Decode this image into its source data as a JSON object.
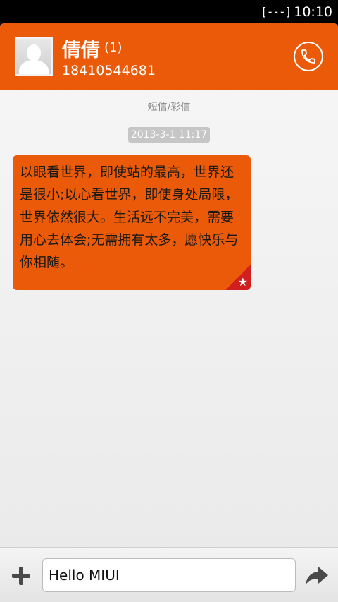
{
  "status_bar": {
    "signal": "[---]",
    "time": "10:10"
  },
  "header": {
    "contact_name": "倩倩",
    "unread_count": "(1)",
    "phone_number": "18410544681"
  },
  "conversation": {
    "type_label": "短信/彩信",
    "timestamp": "2013-3-1 11:17",
    "message": {
      "text": "以眼看世界，即使站的最高，世界还是很小;以心看世界，即使身处局限，世界依然很大。生活远不完美，需要用心去体会;无需拥有太多，愿快乐与你相随。",
      "badge": "★"
    }
  },
  "composer": {
    "input_value": "Hello MIUI"
  },
  "colors": {
    "accent": "#ea5a08",
    "badge": "#d11e1e"
  }
}
